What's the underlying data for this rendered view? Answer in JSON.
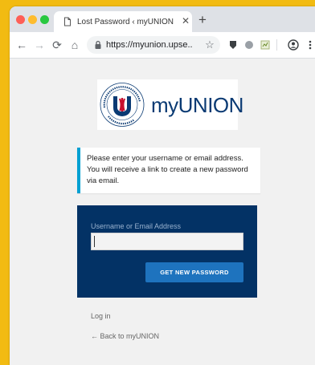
{
  "browser": {
    "tab_title": "Lost Password ‹ myUNION — V",
    "tab_close": "✕",
    "new_tab": "+",
    "url": "https://myunion.upse...",
    "nav": {
      "back": "←",
      "forward": "→",
      "reload": "⟳",
      "home": "⌂"
    },
    "star": "☆"
  },
  "logo": {
    "text": "myUNION"
  },
  "message": {
    "text": "Please enter your username or email address. You will receive a link to create a new password via email."
  },
  "form": {
    "label": "Username or Email Address",
    "value": "",
    "button_label": "GET NEW PASSWORD"
  },
  "links": {
    "login": "Log in",
    "back": "← Back to myUNION"
  },
  "colors": {
    "brand_navy": "#033265",
    "button_blue": "#1e73be",
    "notice_accent": "#00a0d2",
    "backdrop": "#f2bb12"
  }
}
